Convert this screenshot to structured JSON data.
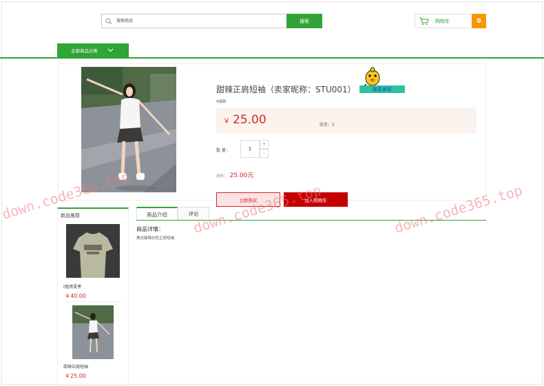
{
  "header": {
    "search_placeholder": "搜索商品",
    "search_button": "搜索",
    "cart_label": "购物车",
    "cart_count": "0"
  },
  "nav": {
    "category_label": "全部商品分类"
  },
  "product": {
    "title": "甜辣正肩短袖（卖家昵称：STU001）",
    "condition": "9成新",
    "currency": "￥",
    "price": "25.00",
    "stock_label": "库存：5",
    "quantity_label": "数 量：",
    "quantity": "1",
    "qty_up": "+",
    "qty_down": "-",
    "total_label": "总价：",
    "total_value": "25.00元",
    "buy_now": "立即购买",
    "add_to_cart": "加入购物车",
    "contact_seller": "联系卖家"
  },
  "sidebar": {
    "title": "新品推荐",
    "items": [
      {
        "name": "t恤男夏季",
        "price": "￥40.00"
      },
      {
        "name": "甜辣正肩短袖",
        "price": "￥25.00"
      }
    ]
  },
  "tabs": {
    "items": [
      {
        "label": "商品介绍"
      },
      {
        "label": "评论"
      }
    ]
  },
  "details": {
    "heading": "商品详情：",
    "text": "美式甜辣白色正肩短袖"
  },
  "watermark": "down.code365.top",
  "colors": {
    "accent_green": "#30a436",
    "price_red": "#d0282a",
    "cart_orange": "#f39800",
    "button_red": "#c40000"
  }
}
